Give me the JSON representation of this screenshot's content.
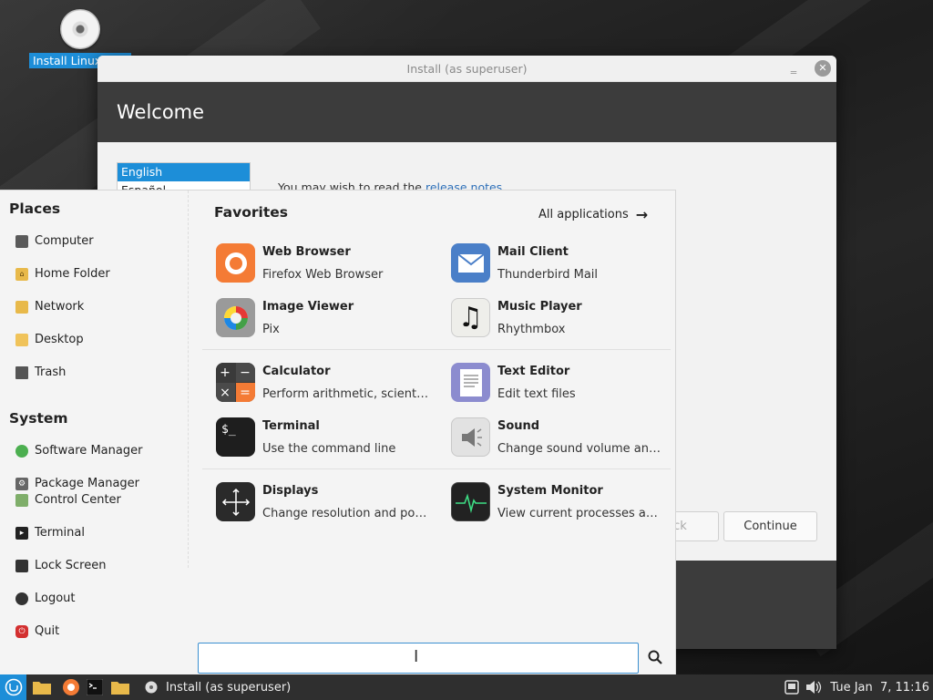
{
  "desktop": {
    "icon_label": "Install Linux Mint"
  },
  "installer": {
    "title": "Install (as superuser)",
    "minimize_symbol": "‗",
    "close_symbol": "✕",
    "header": "Welcome",
    "languages": [
      "English",
      "Español"
    ],
    "release_prefix": "You may wish to read the ",
    "release_link": "release notes",
    "release_suffix": ".",
    "back_label": "Back",
    "continue_label": "Continue"
  },
  "menu": {
    "places_title": "Places",
    "places": [
      {
        "label": "Computer",
        "icon": "computer-icon"
      },
      {
        "label": "Home Folder",
        "icon": "home-folder-icon"
      },
      {
        "label": "Network",
        "icon": "network-icon"
      },
      {
        "label": "Desktop",
        "icon": "desktop-icon"
      },
      {
        "label": "Trash",
        "icon": "trash-icon"
      }
    ],
    "system_title": "System",
    "system": [
      {
        "label": "Software Manager",
        "icon": "software-manager-icon"
      },
      {
        "label": "Package Manager",
        "icon": "package-manager-icon"
      },
      {
        "label": "Control Center",
        "icon": "control-center-icon"
      },
      {
        "label": "Terminal",
        "icon": "terminal-icon"
      },
      {
        "label": "Lock Screen",
        "icon": "lock-icon"
      },
      {
        "label": "Logout",
        "icon": "logout-icon"
      },
      {
        "label": "Quit",
        "icon": "power-icon"
      }
    ],
    "favorites_title": "Favorites",
    "all_applications": "All applications",
    "apps": [
      {
        "name": "Web Browser",
        "desc": "Firefox Web Browser",
        "icon": "firefox-icon"
      },
      {
        "name": "Mail Client",
        "desc": "Thunderbird Mail",
        "icon": "mail-icon"
      },
      {
        "name": "Image Viewer",
        "desc": "Pix",
        "icon": "image-viewer-icon"
      },
      {
        "name": "Music Player",
        "desc": "Rhythmbox",
        "icon": "music-icon"
      },
      {
        "name": "Calculator",
        "desc": "Perform arithmetic, scientific or financial calculations",
        "icon": "calculator-icon"
      },
      {
        "name": "Text Editor",
        "desc": "Edit text files",
        "icon": "text-editor-icon"
      },
      {
        "name": "Terminal",
        "desc": "Use the command line",
        "icon": "terminal-icon"
      },
      {
        "name": "Sound",
        "desc": "Change sound volume and sound events",
        "icon": "sound-icon"
      },
      {
        "name": "Displays",
        "desc": "Change resolution and position of monitors",
        "icon": "displays-icon"
      },
      {
        "name": "System Monitor",
        "desc": "View current processes and monitor system state",
        "icon": "system-monitor-icon"
      }
    ],
    "search_value": ""
  },
  "taskbar": {
    "window_label": "Install (as superuser)",
    "clock": "Tue Jan  7, 11:16"
  },
  "colors": {
    "accent": "#1d8ed8",
    "header_dark": "#3c3c3c"
  }
}
